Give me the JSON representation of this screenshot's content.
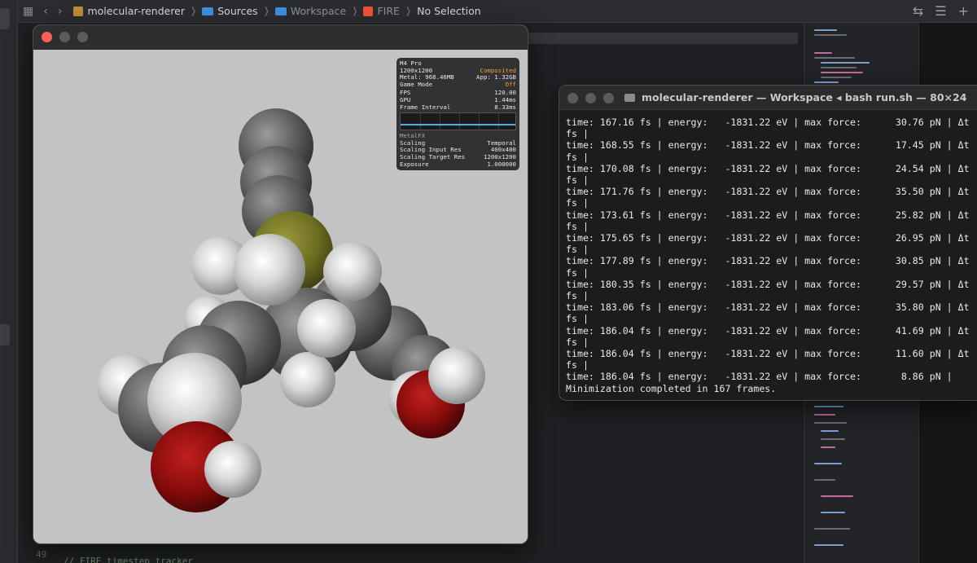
{
  "xcode": {
    "breadcrumbs": [
      {
        "label": "molecular-renderer",
        "icon": "package-icon"
      },
      {
        "label": "Sources",
        "icon": "folder-icon"
      },
      {
        "label": "Workspace",
        "icon": "folder-icon"
      },
      {
        "label": "FIRE",
        "icon": "swift-file-icon"
      },
      {
        "label": "No Selection",
        "icon": ""
      }
    ],
    "line_number": "49",
    "code_line": "// FIRE timestep tracker"
  },
  "hud": {
    "device": "M4 Pro",
    "resolution": "1200x1200",
    "composited": "Composited",
    "metal": "Metal: 968.46MB",
    "app": "App: 1.32GB",
    "game_mode_label": "Game Mode",
    "game_mode_value": "Off",
    "fps_label": "FPS",
    "fps_value": "120.00",
    "gpu_label": "GPU",
    "gpu_value": "1.44ms",
    "frame_interval_label": "Frame Interval",
    "frame_interval_value": "8.33ms",
    "metalfx_label": "MetalFX",
    "scaling_label": "Scaling",
    "scaling_value": "Temporal",
    "scaling_input_label": "Scaling Input Res",
    "scaling_input_value": "400x400",
    "scaling_target_label": "Scaling Target Res",
    "scaling_target_value": "1200x1200",
    "exposure_label": "Exposure",
    "exposure_value": "1.000000"
  },
  "terminal": {
    "title": "molecular-renderer — Workspace ◂ bash run.sh — 80×24",
    "lines": [
      "time: 167.16 fs | energy:   -1831.22 eV | max force:      30.76 pN | Δt",
      "fs |",
      "time: 168.55 fs | energy:   -1831.22 eV | max force:      17.45 pN | Δt",
      "fs |",
      "time: 170.08 fs | energy:   -1831.22 eV | max force:      24.54 pN | Δt",
      "fs |",
      "time: 171.76 fs | energy:   -1831.22 eV | max force:      35.50 pN | Δt",
      "fs |",
      "time: 173.61 fs | energy:   -1831.22 eV | max force:      25.82 pN | Δt",
      "fs |",
      "time: 175.65 fs | energy:   -1831.22 eV | max force:      26.95 pN | Δt",
      "fs |",
      "time: 177.89 fs | energy:   -1831.22 eV | max force:      30.85 pN | Δt",
      "fs |",
      "time: 180.35 fs | energy:   -1831.22 eV | max force:      29.57 pN | Δt",
      "fs |",
      "time: 183.06 fs | energy:   -1831.22 eV | max force:      35.80 pN | Δt",
      "fs |",
      "time: 186.04 fs | energy:   -1831.22 eV | max force:      41.69 pN | Δt",
      "fs |",
      "time: 186.04 fs | energy:   -1831.22 eV | max force:      11.60 pN | Δt",
      "fs |",
      "time: 186.04 fs | energy:   -1831.22 eV | max force:       8.86 pN |",
      "Minimization completed in 167 frames."
    ]
  },
  "colors": {
    "close_button": "#ff5f57",
    "carbon": "#5f5f5f",
    "hydrogen": "#e8e8e8",
    "oxygen": "#9b1010",
    "sulfur": "#7a7a2a"
  }
}
